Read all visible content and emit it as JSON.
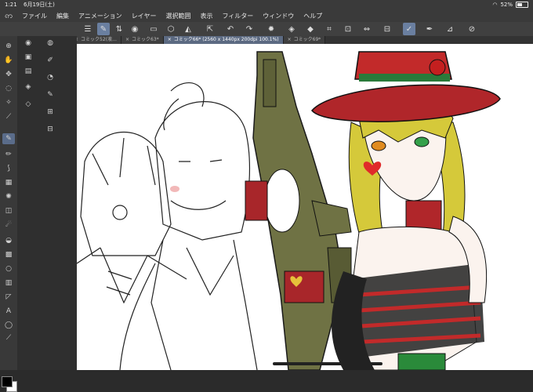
{
  "status": {
    "time": "1:21",
    "date": "6月19日(土)",
    "battery": "52%",
    "battery_level": 0.52
  },
  "menu": {
    "items": [
      "ファイル",
      "編集",
      "アニメーション",
      "レイヤー",
      "選択範囲",
      "表示",
      "フィルター",
      "ウィンドウ",
      "ヘルプ"
    ]
  },
  "toolbar": {
    "icons": [
      "menu-icon",
      "brush-icon",
      "switch-icon",
      "record-icon",
      "undo-icon",
      "redo-icon",
      "clear-icon",
      "fill-icon",
      "transform-icon",
      "scale-icon",
      "rotate-icon",
      "settings-icon",
      "check-icon",
      "pen-icon",
      "ruler-icon",
      "quick-access-icon"
    ]
  },
  "tabs": [
    {
      "label": "コミック52(液…",
      "active": false
    },
    {
      "label": "コミック63*",
      "active": false
    },
    {
      "label": "コミック66* (2560 x 1440px 200dpi 100.1%)",
      "active": true
    },
    {
      "label": "コミック69*",
      "active": false
    }
  ],
  "tools": [
    "zoom-icon",
    "hand-icon",
    "move-icon",
    "lasso-icon",
    "eyedropper-icon",
    "pen-icon",
    "pencil-icon",
    "brush-icon",
    "airbrush-icon",
    "decoration-icon",
    "eraser-icon",
    "blend-icon",
    "fill-icon",
    "gradient-icon",
    "shape-icon",
    "frame-icon",
    "ruler-icon",
    "text-icon",
    "balloon-icon",
    "correction-icon"
  ],
  "colors": {
    "main": "#000000",
    "sub": "#ffffff",
    "accent": "#5a6c8a"
  }
}
